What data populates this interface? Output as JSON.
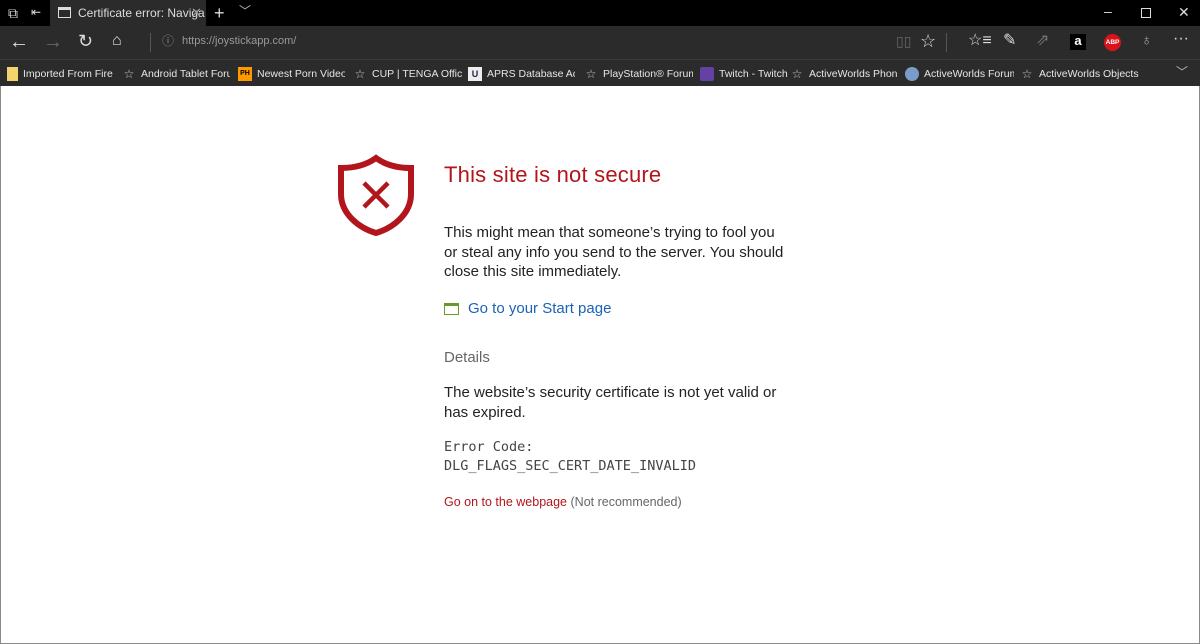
{
  "titlebar": {
    "tab_title": "Certificate error: Naviga",
    "icons": [
      "tab-manager-icon",
      "set-aside-tabs-icon",
      "new-tab-plus-icon",
      "tab-preview-chevron-icon"
    ],
    "window_controls": [
      "minimize",
      "maximize",
      "close"
    ]
  },
  "toolbar": {
    "url": "https://joystickapp.com/",
    "icons": [
      "back-icon",
      "forward-icon",
      "refresh-icon",
      "home-icon",
      "reading-view-icon",
      "favorite-star-icon",
      "favorites-hub-icon",
      "web-note-icon",
      "share-icon",
      "amazon-icon",
      "adblock-plus-icon",
      "extension-icon",
      "more-icon"
    ]
  },
  "bookmarks": [
    {
      "label": "Imported From Firefo",
      "icon": "folder"
    },
    {
      "label": "Android Tablet Forum",
      "icon": "star"
    },
    {
      "label": "Newest Porn Videos -",
      "icon": "PH"
    },
    {
      "label": "CUP | TENGA Official",
      "icon": "star"
    },
    {
      "label": "APRS Database Acces",
      "icon": "U"
    },
    {
      "label": "PlayStation® Forums",
      "icon": "star"
    },
    {
      "label": "Twitch - Twitch",
      "icon": "twitch"
    },
    {
      "label": "ActiveWorlds Phone I",
      "icon": "star"
    },
    {
      "label": "ActiveWorlds Forums",
      "icon": "globe"
    },
    {
      "label": "ActiveWorlds Objects",
      "icon": "star"
    }
  ],
  "page": {
    "title": "This site is not secure",
    "description": "This might mean that someone’s trying to fool you or steal any info you send to the server. You should close this site immediately.",
    "start_page_link": "Go to your Start page",
    "details_heading": "Details",
    "details_text": "The website’s security certificate is not yet valid or has expired.",
    "error_code_label": "Error Code:",
    "error_code": "DLG_FLAGS_SEC_CERT_DATE_INVALID",
    "continue_link": "Go on to the webpage",
    "not_recommended": "(Not recommended)"
  },
  "colors": {
    "accent_red": "#b2151c",
    "link_blue": "#1a64b8",
    "chrome_dark": "#2b2b2b"
  }
}
